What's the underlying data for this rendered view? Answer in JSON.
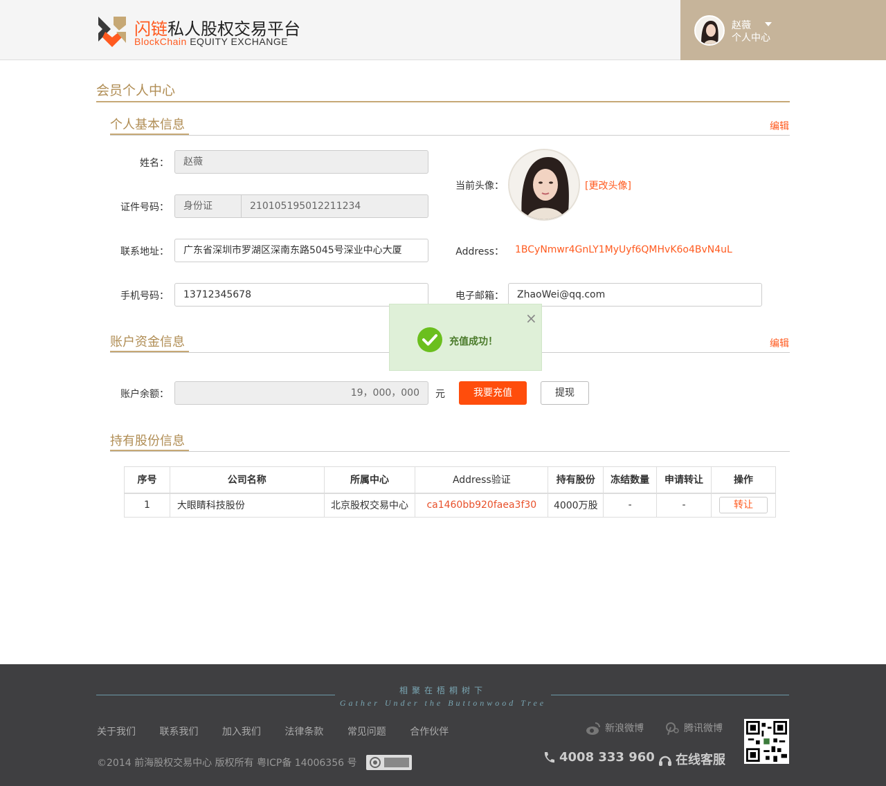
{
  "header": {
    "logo_title_accent": "闪链",
    "logo_title_rest": "私人股权交易平台",
    "logo_sub_accent": "BlockChain",
    "logo_sub_rest": " EQUITY EXCHANGE",
    "user_name": "赵薇",
    "user_center": "个人中心"
  },
  "page_title": "会员个人中心",
  "basic": {
    "section_title": "个人基本信息",
    "edit_label": "编辑",
    "name_label": "姓名：",
    "name_value": "赵薇",
    "id_label": "证件号码：",
    "id_type": "身份证",
    "id_number": "210105195012211234",
    "address_label": "联系地址：",
    "address_value": "广东省深圳市罗湖区深南东路5045号深业中心大厦",
    "phone_label": "手机号码：",
    "phone_value": "13712345678",
    "avatar_label": "当前头像：",
    "change_avatar": "[更改头像]",
    "chain_address_label": "Address：",
    "chain_address_value": "1BCyNmwr4GnLY1MyUyf6QMHvK6o4BvN4uL",
    "email_label": "电子邮箱：",
    "email_value": "ZhaoWei@qq.com"
  },
  "account": {
    "section_title": "账户资金信息",
    "edit_label": "编辑",
    "balance_label": "账户余额：",
    "balance_value": "19，000，000",
    "unit": "元",
    "recharge_label": "我要充值",
    "withdraw_label": "提现"
  },
  "holdings": {
    "section_title": "持有股份信息",
    "columns": [
      "序号",
      "公司名称",
      "所属中心",
      "Address验证",
      "持有股份",
      "冻结数量",
      "申请转让",
      "操作"
    ],
    "rows": [
      {
        "index": "1",
        "company": "大眼睛科技股份",
        "center": "北京股权交易中心",
        "address": "ca1460bb920faea3f30",
        "shares": "4000万股",
        "frozen": "-",
        "applying": "-",
        "action": "转让"
      }
    ]
  },
  "toast": {
    "message": "充值成功！",
    "close": "×"
  },
  "footer": {
    "slogan_cn": "相聚在梧桐树下",
    "slogan_en": "Gather Under the Buttonwood Tree",
    "links": [
      "关于我们",
      "联系我们",
      "加入我们",
      "法律条款",
      "常见问题",
      "合作伙伴"
    ],
    "weibo_sina": "新浪微博",
    "weibo_tencent": "腾讯微博",
    "copyright": "©2014 前海股权交易中心 版权所有   粤ICP备 14006356 号",
    "phone": "4008 333 960",
    "service": "在线客服"
  },
  "colors": {
    "accent": "#ff5a1f",
    "gold": "#b08d54",
    "user_box": "#c6b49a",
    "footer_bg": "#3f3f41"
  }
}
